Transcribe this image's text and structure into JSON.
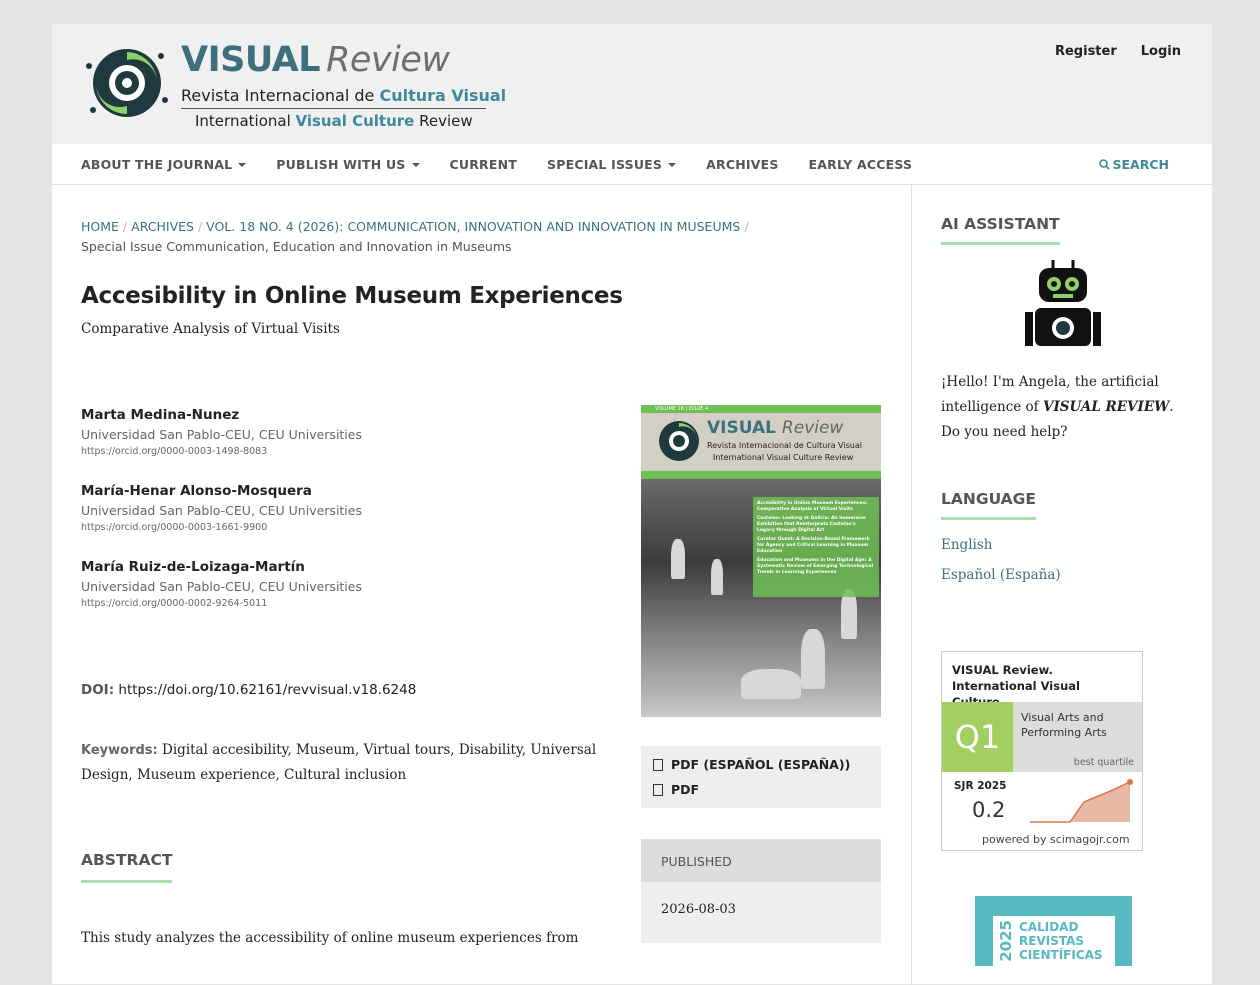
{
  "header": {
    "brand_word1": "VISUAL",
    "brand_word2": "Review",
    "line1_pre": "Revista Internacional de ",
    "line1_hl": "Cultura Visual",
    "line2_pre": "International ",
    "line2_hl": "Visual Culture",
    "line2_post": " Review",
    "register": "Register",
    "login": "Login"
  },
  "nav": {
    "items": [
      "ABOUT THE JOURNAL",
      "PUBLISH WITH US",
      "CURRENT",
      "SPECIAL ISSUES",
      "ARCHIVES",
      "EARLY ACCESS"
    ],
    "search": "SEARCH"
  },
  "breadcrumb": {
    "home": "HOME",
    "archives": "ARCHIVES",
    "issue": "VOL. 18 NO. 4 (2026): COMMUNICATION, INNOVATION AND INNOVATION IN MUSEUMS",
    "current": "Special Issue Communication, Education and Innovation in Museums"
  },
  "article": {
    "title": "Accesibility in Online Museum Experiences",
    "subtitle": "Comparative Analysis of Virtual Visits",
    "authors": [
      {
        "name": "Marta Medina-Nunez",
        "affiliation": "Universidad San Pablo-CEU, CEU Universities",
        "orcid": "https://orcid.org/0000-0003-1498-8083"
      },
      {
        "name": "María-Henar Alonso-Mosquera",
        "affiliation": "Universidad San Pablo-CEU, CEU Universities",
        "orcid": "https://orcid.org/0000-0003-1661-9900"
      },
      {
        "name": "María Ruiz-de-Loizaga-Martín",
        "affiliation": "Universidad San Pablo-CEU, CEU Universities",
        "orcid": "https://orcid.org/0000-0002-9264-5011"
      }
    ],
    "doi_label": "DOI:",
    "doi": "https://doi.org/10.62161/revvisual.v18.6248",
    "keywords_label": "Keywords:",
    "keywords": "Digital accesibility, Museum, Virtual tours, Disability, Universal Design, Museum experience, Cultural inclusion",
    "abstract_heading": "ABSTRACT",
    "abstract_text": "This study analyzes the accessibility of online museum experiences from"
  },
  "cover": {
    "band": "VOLUME 18 | ISSUE 4",
    "title1": "VISUAL",
    "title2": "Review",
    "line1": "Revista Internacional de Cultura Visual",
    "line2": "International Visual Culture Review",
    "toc": [
      "Accesibility in Online Museum Experiences: Comparative Analysis of Virtual Visits",
      "Castelao: Looking at Galicia: An Immersive Exhibition that Reinterprets Castelao's Legacy through Digital Art",
      "Curator Quest: A Decision-Based Framework for Agency and Critical Learning in Museum Education",
      "Education and Museums in the Digital Age: A Systematic Review of Emerging Technological Trends in Learning Experiences"
    ]
  },
  "galleys": [
    "PDF (ESPAÑOL (ESPAÑA))",
    "PDF"
  ],
  "published": {
    "label": "PUBLISHED",
    "date": "2026-08-03"
  },
  "sidebar": {
    "ai_heading": "AI ASSISTANT",
    "ai_pre": "¡Hello! I'm Angela, the artificial intelligence of ",
    "ai_em": "VISUAL REVIEW",
    "ai_post": ". Do you need help?",
    "lang_heading": "LANGUAGE",
    "languages": [
      "English",
      "Español (España)"
    ],
    "sjr": {
      "title": "VISUAL Review. International Visual Culture…",
      "quartile": "Q1",
      "category": "Visual Arts and Performing Arts",
      "best": "best quartile",
      "year_label": "SJR 2025",
      "value": "0.2",
      "powered": "powered by scimagojr.com"
    },
    "calidad": {
      "year": "2025",
      "line1": "CALIDAD",
      "line2": "REVISTAS",
      "line3": "CIENTÍFICAS"
    }
  },
  "colors": {
    "accent": "#3e6f7d",
    "green": "#a8ddb0",
    "q1": "#a3cf62"
  }
}
